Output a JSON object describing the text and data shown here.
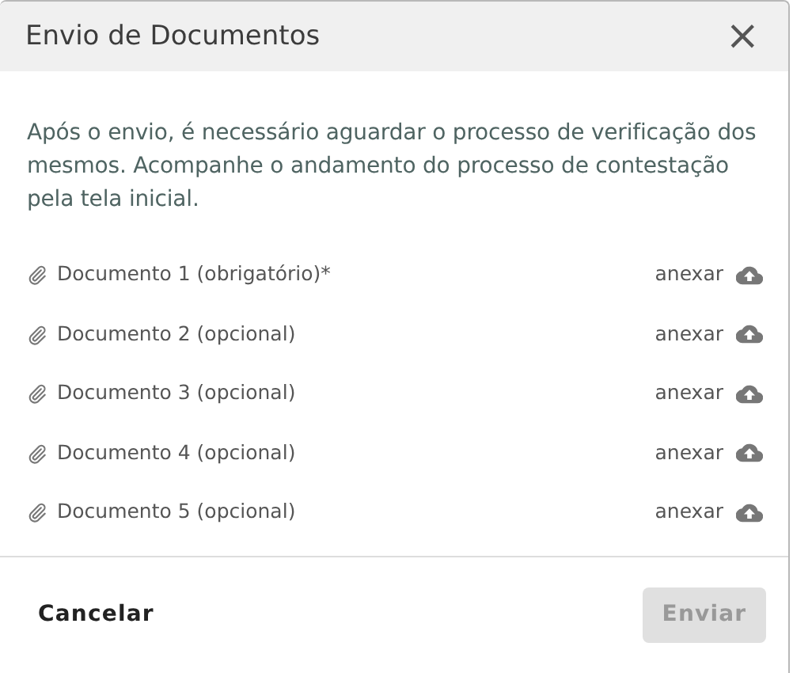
{
  "dialog": {
    "title": "Envio de Documentos",
    "close": "×"
  },
  "message": "Após o envio, é necessário aguardar o processo de verificação dos mesmos. Acompanhe o andamento do processo de contestação pela tela inicial.",
  "documents": [
    {
      "label": "Documento 1 (obrigatório)*",
      "action": "anexar"
    },
    {
      "label": "Documento 2 (opcional)",
      "action": "anexar"
    },
    {
      "label": "Documento 3 (opcional)",
      "action": "anexar"
    },
    {
      "label": "Documento 4 (opcional)",
      "action": "anexar"
    },
    {
      "label": "Documento 5 (opcional)",
      "action": "anexar"
    }
  ],
  "buttons": [
    {
      "label": "Cancelar",
      "kind": "text",
      "disabled": false
    },
    {
      "label": "Enviar",
      "kind": "filled",
      "disabled": true
    }
  ]
}
